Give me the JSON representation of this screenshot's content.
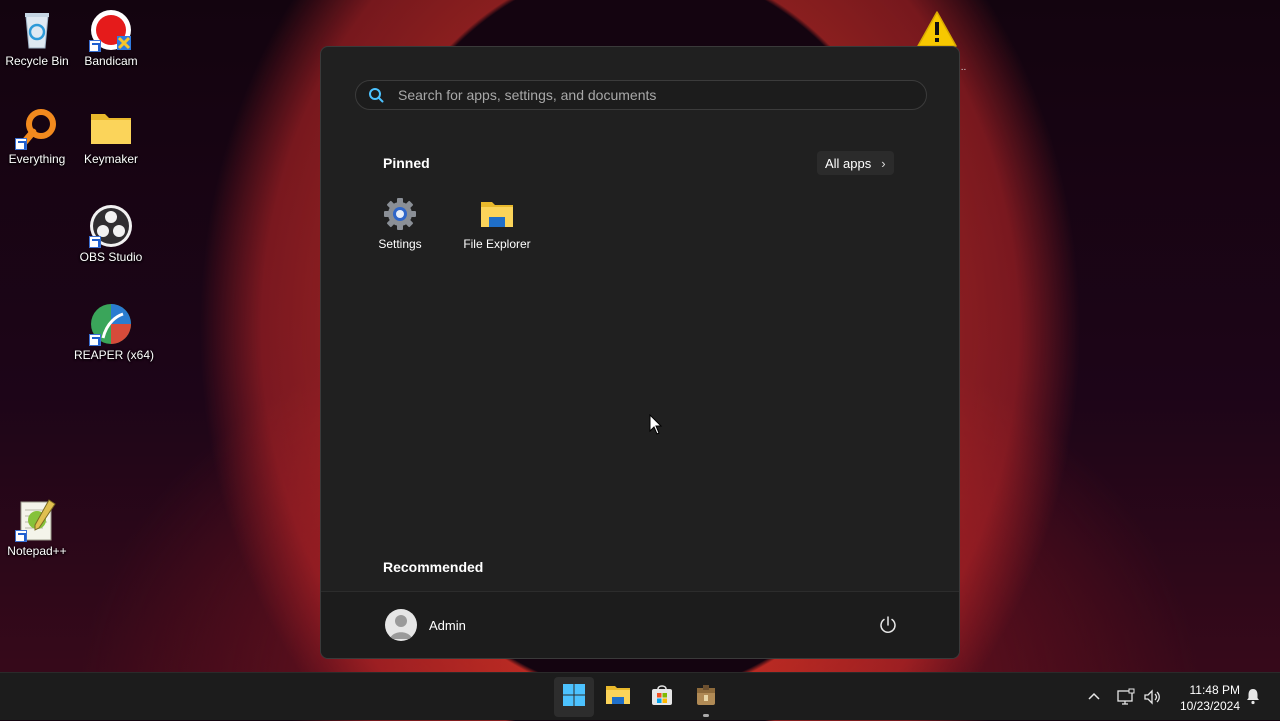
{
  "desktop": {
    "icons": [
      {
        "label": "Recycle Bin"
      },
      {
        "label": "Bandicam"
      },
      {
        "label": "Everything"
      },
      {
        "label": "Keymaker"
      },
      {
        "label": "OBS Studio"
      },
      {
        "label": "REAPER (x64)"
      },
      {
        "label": "Notepad++"
      }
    ],
    "warning_ellipsis": "..."
  },
  "start_menu": {
    "search_placeholder": "Search for apps, settings, and documents",
    "pinned_title": "Pinned",
    "all_apps_label": "All apps",
    "pinned_apps": [
      {
        "label": "Settings",
        "icon": "settings-gear-icon"
      },
      {
        "label": "File Explorer",
        "icon": "folder-icon"
      }
    ],
    "recommended_title": "Recommended",
    "user_name": "Admin"
  },
  "taskbar": {
    "items": [
      "start-icon",
      "file-explorer-icon",
      "store-icon",
      "package-app-icon"
    ],
    "time": "11:48 PM",
    "date": "10/23/2024"
  },
  "colors": {
    "menu_bg": "#202020",
    "taskbar_bg": "#1c1c1c",
    "accent": "#4cc2ff"
  }
}
